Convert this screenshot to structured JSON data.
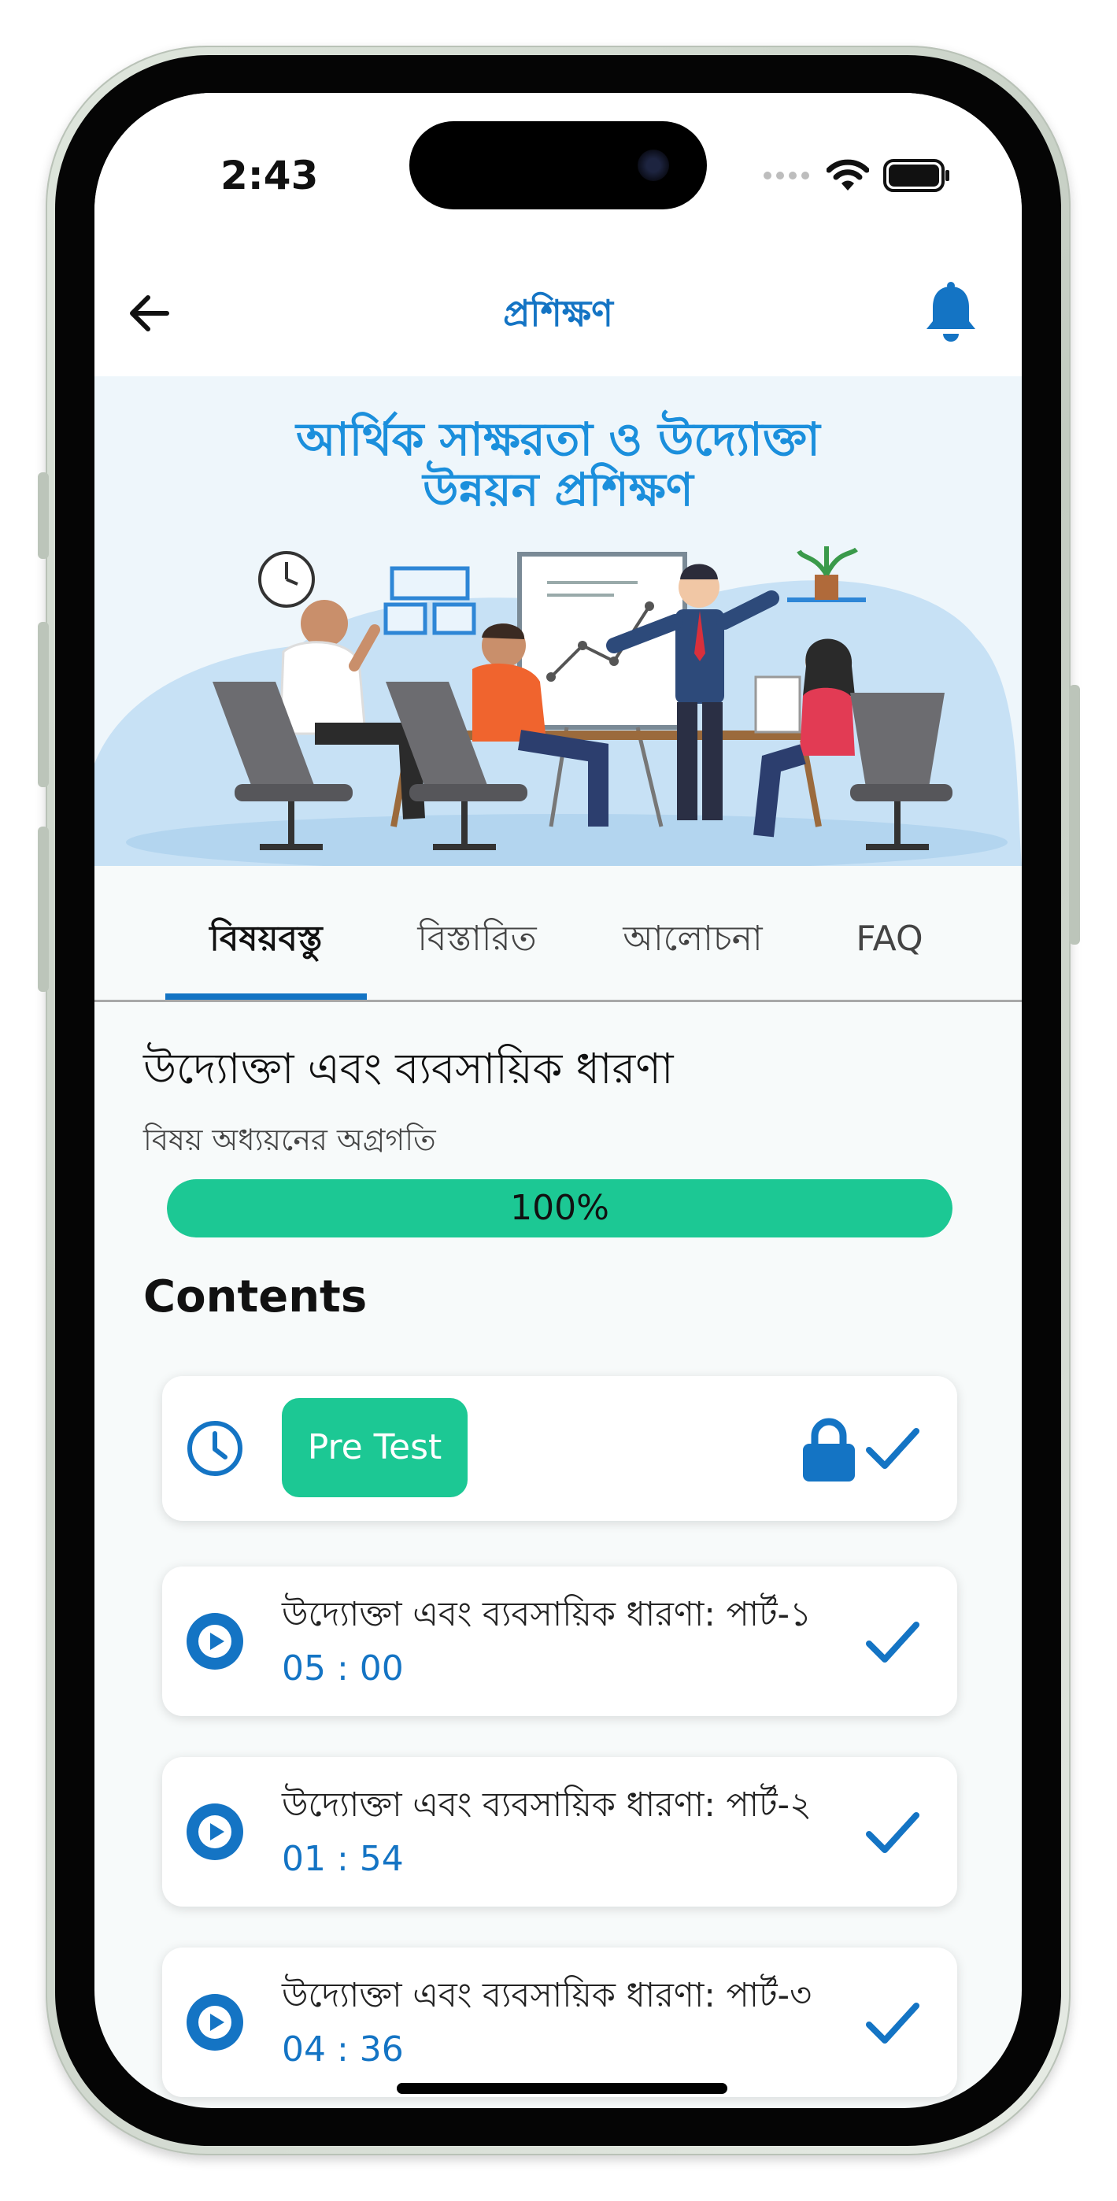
{
  "status_bar": {
    "time": "2:43"
  },
  "header": {
    "title": "প্রশিক্ষণ",
    "back_icon": "arrow-left-icon",
    "bell_icon": "bell-icon"
  },
  "banner": {
    "line1": "আর্থিক সাক্ষরতা ও উদ্যোক্তা",
    "line2": "উন্নয়ন প্রশিক্ষণ"
  },
  "tabs": [
    {
      "label": "বিষয়বস্তু",
      "active": true
    },
    {
      "label": "বিস্তারিত",
      "active": false
    },
    {
      "label": "আলোচনা",
      "active": false
    },
    {
      "label": "FAQ",
      "active": false
    }
  ],
  "section": {
    "title": "উদ্যোক্তা এবং ব্যবসায়িক ধারণা",
    "progress_label": "বিষয় অধ্যয়নের অগ্রগতি",
    "progress_text": "100%",
    "progress_value": 1.0
  },
  "contents_heading": "Contents",
  "pretest": {
    "label": "Pre Test",
    "locked": true,
    "completed": true
  },
  "lessons": [
    {
      "title": "উদ্যোক্তা এবং ব্যবসায়িক ধারণা: পার্ট-১",
      "duration": "05 : 00",
      "completed": true
    },
    {
      "title": "উদ্যোক্তা এবং ব্যবসায়িক ধারণা: পার্ট-২",
      "duration": "01 : 54",
      "completed": true
    },
    {
      "title": "উদ্যোক্তা এবং ব্যবসায়িক ধারণা: পার্ট-৩",
      "duration": "04 : 36",
      "completed": true
    }
  ],
  "colors": {
    "primary": "#1474c4",
    "accent": "#1cc894",
    "banner_text": "#1b8fdc"
  }
}
